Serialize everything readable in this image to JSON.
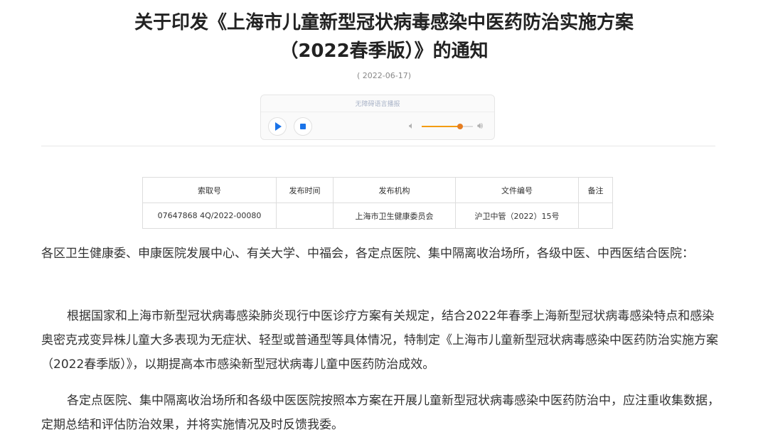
{
  "article": {
    "title_line1": "关于印发《上海市儿童新型冠状病毒感染中医药防治实施方案",
    "title_line2": "（2022春季版）》的通知",
    "date": "( 2022-06-17)"
  },
  "player": {
    "label": "无障碍语言播报",
    "volume_level": 0.75,
    "accent_color": "#1a73e8",
    "volume_color": "#e67e22",
    "icons": [
      "play-icon",
      "stop-icon",
      "volume-low-icon",
      "volume-high-icon"
    ]
  },
  "meta_table": {
    "headers": [
      "索取号",
      "发布时间",
      "发布机构",
      "文件编号",
      "备注"
    ],
    "row": [
      "07647868 4Q/2022-00080",
      "",
      "上海市卫生健康委员会",
      "沪卫中管（2022）15号",
      ""
    ]
  },
  "body": {
    "paragraphs": [
      "各区卫生健康委、申康医院发展中心、有关大学、中福会，各定点医院、集中隔离收治场所，各级中医、中西医结合医院：",
      "根据国家和上海市新型冠状病毒感染肺炎现行中医诊疗方案有关规定，结合2022年春季上海新型冠状病毒感染特点和感染奥密克戎变异株儿童大多表现为无症状、轻型或普通型等具体情况，特制定《上海市儿童新型冠状病毒感染中医药防治实施方案（2022春季版）》，以期提高本市感染新型冠状病毒儿童中医药防治成效。",
      "各定点医院、集中隔离收治场所和各级中医医院按照本方案在开展儿童新型冠状病毒感染中医药防治中，应注重收集数据，定期总结和评估防治效果，并将实施情况及时反馈我委。"
    ]
  }
}
